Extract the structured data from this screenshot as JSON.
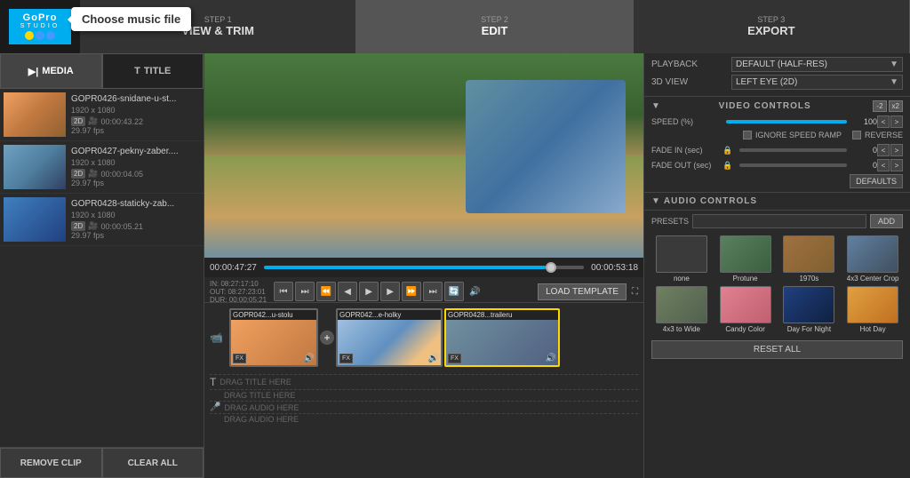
{
  "header": {
    "logo": "GoPro Studio",
    "tooltip": "Choose music file",
    "steps": [
      {
        "num": "STEP 1",
        "label": "VIEW & TRIM",
        "active": false
      },
      {
        "num": "STEP 2",
        "label": "EDIT",
        "active": true
      },
      {
        "num": "STEP 3",
        "label": "EXPORT",
        "active": false
      }
    ]
  },
  "left_panel": {
    "tabs": [
      {
        "id": "media",
        "label": "MEDIA",
        "icon": "▶",
        "active": true
      },
      {
        "id": "title",
        "label": "TITLE",
        "icon": "T",
        "active": false
      }
    ],
    "media_items": [
      {
        "name": "GOPR0426-snidane-u-st...",
        "res": "1920 x 1080",
        "duration": "00:00:43.22",
        "fps": "29.97 fps",
        "badge": "2D",
        "img": "img1"
      },
      {
        "name": "GOPR0427-pekny-zaber....",
        "res": "1920 x 1080",
        "duration": "00:00:04.05",
        "fps": "29.97 fps",
        "badge": "2D",
        "img": "img2"
      },
      {
        "name": "GOPR0428-staticky-zab...",
        "res": "1920 x 1080",
        "duration": "00:00:05.21",
        "fps": "29.97 fps",
        "badge": "2D",
        "img": "img3"
      }
    ],
    "bottom_buttons": [
      "REMOVE CLIP",
      "CLEAR ALL"
    ]
  },
  "preview": {
    "time_current": "00:00:47:27",
    "time_total": "00:00:53:18",
    "in_point": "IN: 08:27:17:10",
    "out_point": "OUT: 08:27:23:01",
    "duration": "DUR: 00:00:05:21",
    "load_template": "LOAD TEMPLATE"
  },
  "timeline": {
    "clips": [
      {
        "label": "GOPR042...u-stolu",
        "img": "c1",
        "selected": false
      },
      {
        "label": "GOPR042...e-holky",
        "img": "c2",
        "selected": false
      },
      {
        "label": "GOPR0428...traileru",
        "img": "c3",
        "selected": true
      }
    ],
    "drag_areas": [
      "DRAG TITLE HERE",
      "DRAG TITLE HERE",
      "DRAG AUDIO HERE",
      "DRAG AUDIO HERE"
    ]
  },
  "right_panel": {
    "playback_label": "PLAYBACK",
    "playback_value": "DEFAULT (HALF-RES)",
    "view3d_label": "3D VIEW",
    "view3d_value": "LEFT EYE (2D)",
    "video_controls": {
      "title": "VIDEO CONTROLS",
      "speed_minus": "-2",
      "speed_plus": "x2",
      "speed_label": "SPEED (%)",
      "speed_value": "100",
      "ignore_speed_ramp": "IGNORE SPEED RAMP",
      "reverse": "REVERSE",
      "fade_in_label": "FADE IN (sec)",
      "fade_in_value": "0",
      "fade_out_label": "FADE OUT (sec)",
      "fade_out_value": "0",
      "defaults_btn": "DEFAULTS"
    },
    "audio_controls": {
      "title": "AUDIO CONTROLS",
      "presets_label": "PRESETS",
      "add_btn": "ADD",
      "presets": [
        {
          "id": "none",
          "label": "none",
          "img": "preset-img-none"
        },
        {
          "id": "protune",
          "label": "Protune",
          "img": "preset-img-protune"
        },
        {
          "id": "1970s",
          "label": "1970s",
          "img": "preset-img-1970s"
        },
        {
          "id": "4x3center",
          "label": "4x3 Center Crop",
          "img": "preset-img-4x3center"
        },
        {
          "id": "4x3wide",
          "label": "4x3 to Wide",
          "img": "preset-img-4x3wide"
        },
        {
          "id": "candy",
          "label": "Candy Color",
          "img": "preset-img-candy"
        },
        {
          "id": "daynight",
          "label": "Day For Night",
          "img": "preset-img-daynight"
        },
        {
          "id": "hotday",
          "label": "Hot Day",
          "img": "preset-img-hotday"
        }
      ],
      "reset_all": "RESET ALL"
    }
  }
}
